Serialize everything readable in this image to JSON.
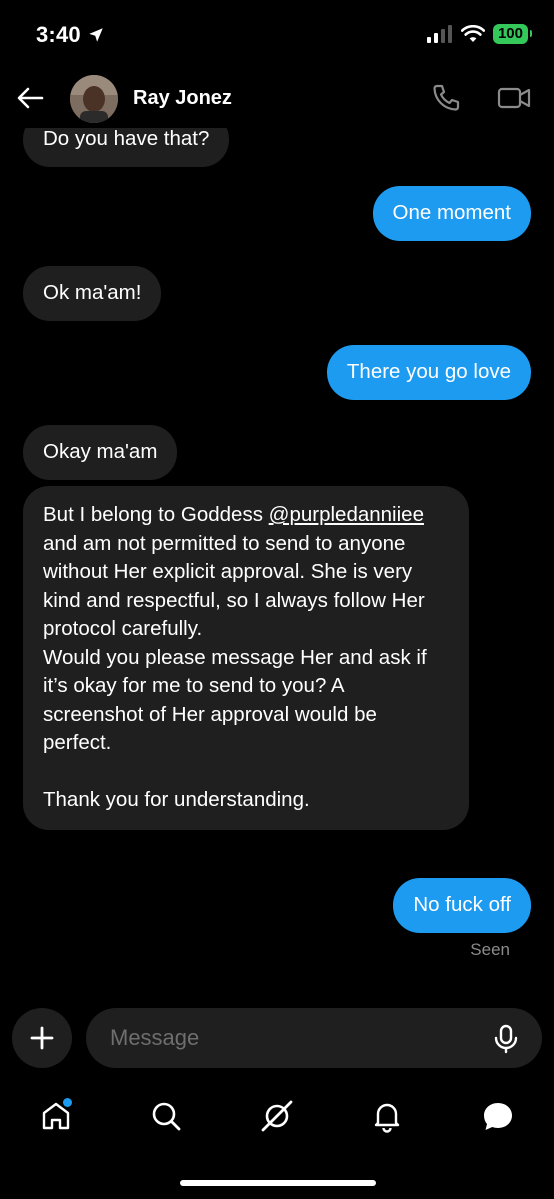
{
  "status_bar": {
    "time": "3:40",
    "battery": "100"
  },
  "header": {
    "contact_name": "Ray Jonez"
  },
  "messages": [
    {
      "direction": "in",
      "text": "Do you have that?"
    },
    {
      "direction": "out",
      "text": "One moment"
    },
    {
      "direction": "in",
      "text": "Ok ma'am!"
    },
    {
      "direction": "out",
      "text": "There you go love"
    },
    {
      "direction": "in",
      "text": "Okay ma'am"
    },
    {
      "direction": "in",
      "text_before_mention": "But I belong to Goddess ",
      "mention": "@purpledanniiee",
      "text_after_mention": "  and am not permitted to send to anyone without Her explicit approval. She is very kind and respectful, so I always follow Her protocol carefully.\nWould you please message Her and ask if it’s okay for me to send to you? A screenshot of Her approval would be perfect.\n\nThank you for understanding."
    },
    {
      "direction": "out",
      "text": "No fuck off"
    }
  ],
  "seen_label": "Seen",
  "composer": {
    "placeholder": "Message"
  },
  "nav": {
    "items": [
      "home-icon",
      "search-icon",
      "grok-icon",
      "notifications-icon",
      "messages-icon"
    ],
    "home_has_badge": true
  },
  "colors": {
    "accent": "#1d9bf0",
    "incoming_bubble": "#1f1f1f",
    "background": "#000000"
  }
}
